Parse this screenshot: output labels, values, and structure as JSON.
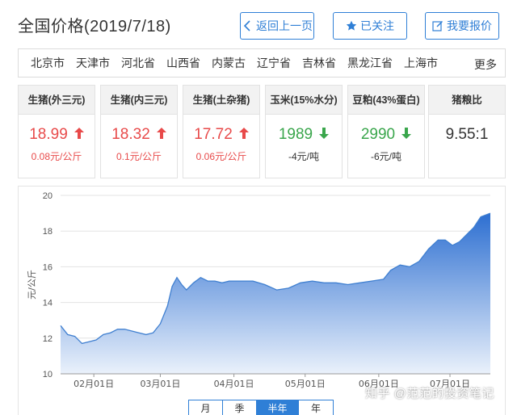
{
  "header": {
    "title": "全国价格(2019/7/18)",
    "back_label": "返回上一页",
    "follow_label": "已关注",
    "report_label": "我要报价"
  },
  "regions": {
    "items": [
      "北京市",
      "天津市",
      "河北省",
      "山西省",
      "内蒙古",
      "辽宁省",
      "吉林省",
      "黑龙江省",
      "上海市"
    ],
    "more_label": "更多"
  },
  "cards": [
    {
      "title": "生猪(外三元)",
      "value": "18.99",
      "trend": "up",
      "change": "0.08元/公斤"
    },
    {
      "title": "生猪(内三元)",
      "value": "18.32",
      "trend": "up",
      "change": "0.1元/公斤"
    },
    {
      "title": "生猪(土杂猪)",
      "value": "17.72",
      "trend": "up",
      "change": "0.06元/公斤"
    },
    {
      "title": "玉米(15%水分)",
      "value": "1989",
      "trend": "down",
      "change": "-4元/吨"
    },
    {
      "title": "豆粕(43%蛋白)",
      "value": "2990",
      "trend": "down",
      "change": "-6元/吨"
    },
    {
      "title": "猪粮比",
      "value": "9.55:1",
      "trend": "none",
      "change": ""
    }
  ],
  "colors": {
    "accent": "#2f7fd6",
    "up": "#e84a4a",
    "down": "#3aa64c",
    "line": "#3f7fd0"
  },
  "chart_data": {
    "type": "area",
    "ylabel": "元/公斤",
    "ylim": [
      10,
      20
    ],
    "yticks": [
      10,
      12,
      14,
      16,
      18,
      20
    ],
    "xlabel": "",
    "xlim": [
      "2019-01-18",
      "2019-07-18"
    ],
    "xticks": [
      {
        "date": "2019-02-01",
        "label": "02月01日"
      },
      {
        "date": "2019-03-01",
        "label": "03月01日"
      },
      {
        "date": "2019-04-01",
        "label": "04月01日"
      },
      {
        "date": "2019-05-01",
        "label": "05月01日"
      },
      {
        "date": "2019-06-01",
        "label": "06月01日"
      },
      {
        "date": "2019-07-01",
        "label": "07月01日"
      }
    ],
    "grid": true,
    "series": [
      {
        "x": [
          "2019-01-18",
          "2019-01-21",
          "2019-01-24",
          "2019-01-27",
          "2019-01-30",
          "2019-02-02",
          "2019-02-05",
          "2019-02-08",
          "2019-02-11",
          "2019-02-14",
          "2019-02-17",
          "2019-02-20",
          "2019-02-23",
          "2019-02-26",
          "2019-03-01",
          "2019-03-04",
          "2019-03-06",
          "2019-03-08",
          "2019-03-10",
          "2019-03-12",
          "2019-03-15",
          "2019-03-18",
          "2019-03-21",
          "2019-03-24",
          "2019-03-27",
          "2019-03-30",
          "2019-04-04",
          "2019-04-09",
          "2019-04-14",
          "2019-04-19",
          "2019-04-24",
          "2019-04-29",
          "2019-05-04",
          "2019-05-09",
          "2019-05-14",
          "2019-05-19",
          "2019-05-24",
          "2019-05-29",
          "2019-06-03",
          "2019-06-06",
          "2019-06-10",
          "2019-06-14",
          "2019-06-18",
          "2019-06-22",
          "2019-06-26",
          "2019-06-29",
          "2019-07-02",
          "2019-07-05",
          "2019-07-08",
          "2019-07-11",
          "2019-07-14",
          "2019-07-18"
        ],
        "y": [
          12.7,
          12.2,
          12.1,
          11.7,
          11.8,
          11.9,
          12.2,
          12.3,
          12.5,
          12.5,
          12.4,
          12.3,
          12.2,
          12.3,
          12.8,
          13.8,
          14.9,
          15.4,
          15.0,
          14.7,
          15.1,
          15.4,
          15.2,
          15.2,
          15.1,
          15.2,
          15.2,
          15.2,
          15.0,
          14.7,
          14.8,
          15.1,
          15.2,
          15.1,
          15.1,
          15.0,
          15.1,
          15.2,
          15.3,
          15.8,
          16.1,
          16.0,
          16.3,
          17.0,
          17.5,
          17.5,
          17.2,
          17.4,
          17.8,
          18.2,
          18.8,
          19.0
        ]
      }
    ]
  },
  "range_tabs": {
    "items": [
      "月",
      "季",
      "半年",
      "年"
    ],
    "active": "半年"
  },
  "watermark": "知乎 @范范的投资笔记"
}
